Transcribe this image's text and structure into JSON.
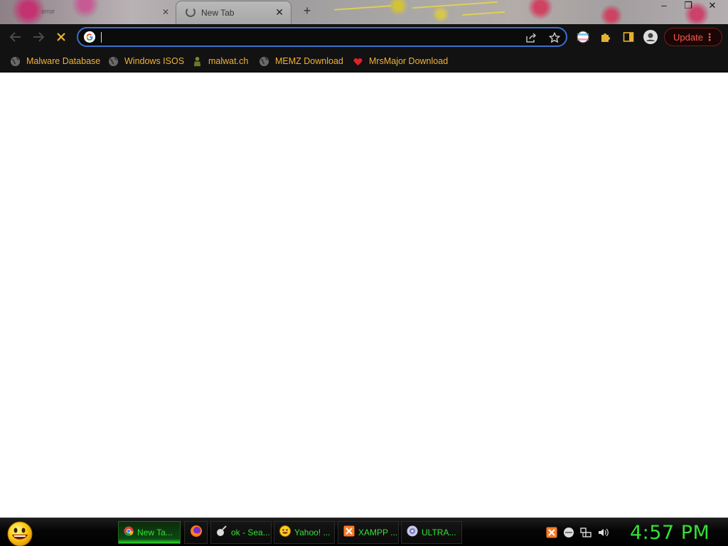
{
  "browser": {
    "background_tab": {
      "title": "error"
    },
    "active_tab": {
      "title": "New Tab"
    },
    "omnibox": {
      "value": "",
      "placeholder": ""
    },
    "update_button": {
      "label": "Update"
    },
    "accent_color": "#3b6fd0",
    "bookmark_color": "#f2b233"
  },
  "bookmarks": [
    {
      "label": "Malware Database",
      "icon": "globe-icon"
    },
    {
      "label": "Windows ISOS",
      "icon": "globe-icon"
    },
    {
      "label": "malwat.ch",
      "icon": "hazmat-icon"
    },
    {
      "label": "MEMZ Download",
      "icon": "globe-icon"
    },
    {
      "label": "MrsMajor Download",
      "icon": "heart-icon"
    }
  ],
  "taskbar": {
    "tasks": [
      {
        "label": "New Ta...",
        "icon": "chrome-icon",
        "active": true
      },
      {
        "label": "",
        "icon": "firefox-icon",
        "active": false
      },
      {
        "label": "ok - Sea...",
        "icon": "search-app-icon",
        "active": false
      },
      {
        "label": "Yahoo! ...",
        "icon": "yahoo-smiley-icon",
        "active": false
      },
      {
        "label": "XAMPP ...",
        "icon": "xampp-icon",
        "active": false
      },
      {
        "label": "ULTRA...",
        "icon": "disc-icon",
        "active": false
      }
    ],
    "tray_icons": [
      "xampp-tray-icon",
      "network-globe-icon",
      "network-icon",
      "volume-icon"
    ],
    "clock": "4:57 PM",
    "accent_color": "#33e033"
  }
}
